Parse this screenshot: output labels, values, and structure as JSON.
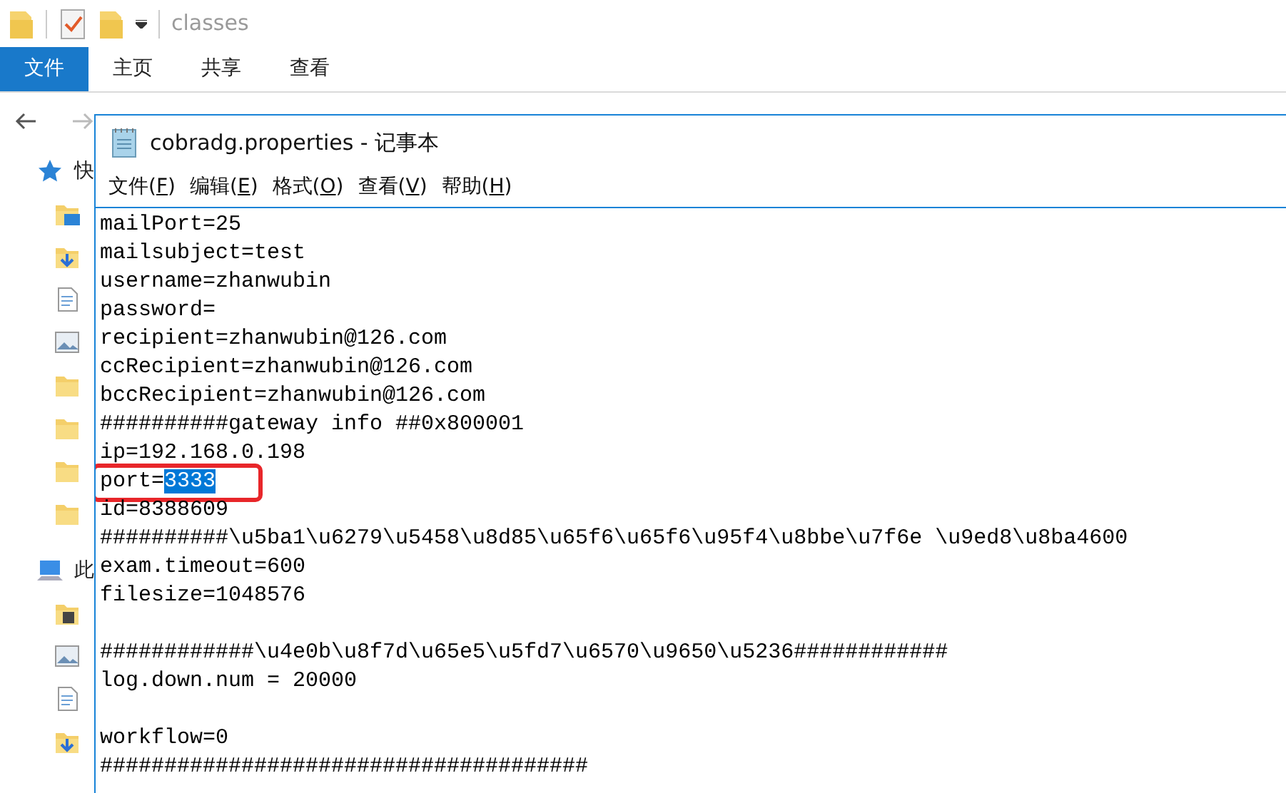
{
  "explorer": {
    "title": "classes",
    "ribbon_tabs": [
      {
        "label": "文件",
        "selected": true
      },
      {
        "label": "主页",
        "selected": false
      },
      {
        "label": "共享",
        "selected": false
      },
      {
        "label": "查看",
        "selected": false
      }
    ],
    "sidebar": [
      {
        "kind": "star",
        "label": "快"
      },
      {
        "kind": "desktop"
      },
      {
        "kind": "download"
      },
      {
        "kind": "document"
      },
      {
        "kind": "picture"
      },
      {
        "kind": "folder"
      },
      {
        "kind": "folder"
      },
      {
        "kind": "folder"
      },
      {
        "kind": "folder"
      },
      {
        "kind": "computer",
        "label": "此"
      },
      {
        "kind": "video"
      },
      {
        "kind": "picture"
      },
      {
        "kind": "document"
      },
      {
        "kind": "download"
      }
    ]
  },
  "notepad": {
    "title": "cobradg.properties - 记事本",
    "menu": [
      {
        "prefix": "文件(",
        "key": "F",
        "suffix": ")"
      },
      {
        "prefix": "编辑(",
        "key": "E",
        "suffix": ")"
      },
      {
        "prefix": "格式(",
        "key": "O",
        "suffix": ")"
      },
      {
        "prefix": "查看(",
        "key": "V",
        "suffix": ")"
      },
      {
        "prefix": "帮助(",
        "key": "H",
        "suffix": ")"
      }
    ],
    "lines": [
      {
        "text": "mailPort=25"
      },
      {
        "text": "mailsubject=test"
      },
      {
        "text": "username=zhanwubin"
      },
      {
        "text": "password="
      },
      {
        "text": "recipient=zhanwubin@126.com"
      },
      {
        "text": "ccRecipient=zhanwubin@126.com"
      },
      {
        "text": "bccRecipient=zhanwubin@126.com"
      },
      {
        "text": "##########gateway info ##0x800001"
      },
      {
        "text": "ip=192.168.0.198"
      },
      {
        "text": "port=",
        "selection": "3333",
        "circled": true
      },
      {
        "text": "id=8388609"
      },
      {
        "text": "##########\\u5ba1\\u6279\\u5458\\u8d85\\u65f6\\u65f6\\u95f4\\u8bbe\\u7f6e \\u9ed8\\u8ba4600"
      },
      {
        "text": "exam.timeout=600"
      },
      {
        "text": "filesize=1048576"
      },
      {
        "blank_before": true,
        "text": "############\\u4e0b\\u8f7d\\u65e5\\u5fd7\\u6570\\u9650\\u5236############"
      },
      {
        "text": "log.down.num = 20000"
      },
      {
        "blank_before": true,
        "text": "workflow=0"
      },
      {
        "text": "######################################"
      }
    ]
  }
}
